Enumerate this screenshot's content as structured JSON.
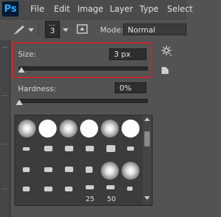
{
  "menubar": {
    "logo": "Ps",
    "items": [
      "File",
      "Edit",
      "Image",
      "Layer",
      "Type",
      "Select"
    ]
  },
  "options": {
    "brush_size": "3",
    "mode_label": "Mode:",
    "mode_value": "Normal"
  },
  "panel": {
    "size_label": "Size:",
    "size_value": "3 px",
    "size_slider_fraction": 0.01,
    "hardness_label": "Hardness:",
    "hardness_value": "0%",
    "hardness_slider_fraction": 0.0,
    "brush_numbers": [
      "25",
      "50"
    ]
  },
  "colors": {
    "highlight": "#c8282b",
    "ps_blue": "#31a8ff"
  }
}
